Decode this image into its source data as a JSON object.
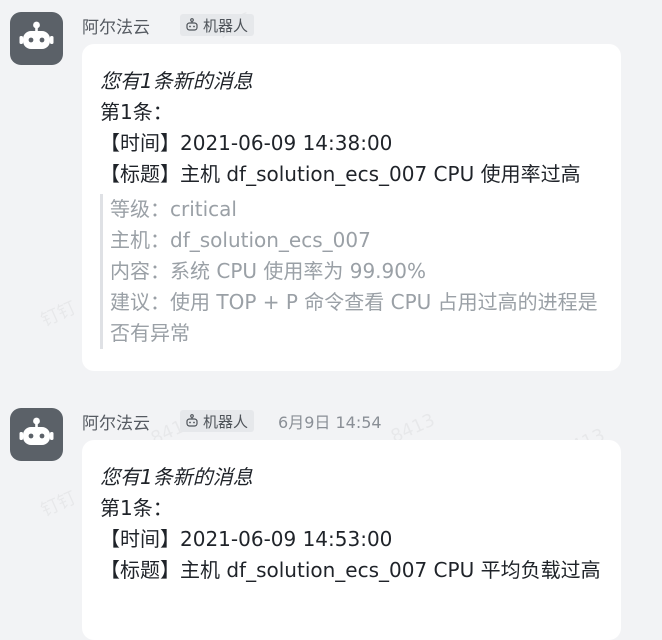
{
  "watermarks": [
    "钉钉",
    "8413",
    "钉钉",
    "8413",
    "钉钉",
    "8413",
    "钉钉",
    "8413",
    "钉钉",
    "8413"
  ],
  "messages": [
    {
      "sender": "阿尔法云",
      "badge": "机器人",
      "time": "",
      "title": "您有1条新的消息",
      "count_line": "第1条：",
      "time_line": "【时间】2021-06-09 14:38:00",
      "subject_line": "【标题】主机 df_solution_ecs_007 CPU 使用率过高",
      "quote": [
        "等级：critical",
        "主机：df_solution_ecs_007",
        "内容：系统 CPU 使用率为 99.90%",
        "建议：使用 TOP + P 命令查看 CPU 占用过高的进程是否有异常"
      ]
    },
    {
      "sender": "阿尔法云",
      "badge": "机器人",
      "time": "6月9日 14:54",
      "title": "您有1条新的消息",
      "count_line": "第1条：",
      "time_line": "【时间】2021-06-09 14:53:00",
      "subject_line": "【标题】主机 df_solution_ecs_007 CPU 平均负载过高"
    }
  ],
  "icons": {
    "avatar": "robot-avatar-icon",
    "badge": "robot-icon"
  },
  "colors": {
    "background": "#f2f3f5",
    "avatar": "#5b6168",
    "bubble": "#ffffff",
    "quote_text": "#9aa0a6"
  }
}
